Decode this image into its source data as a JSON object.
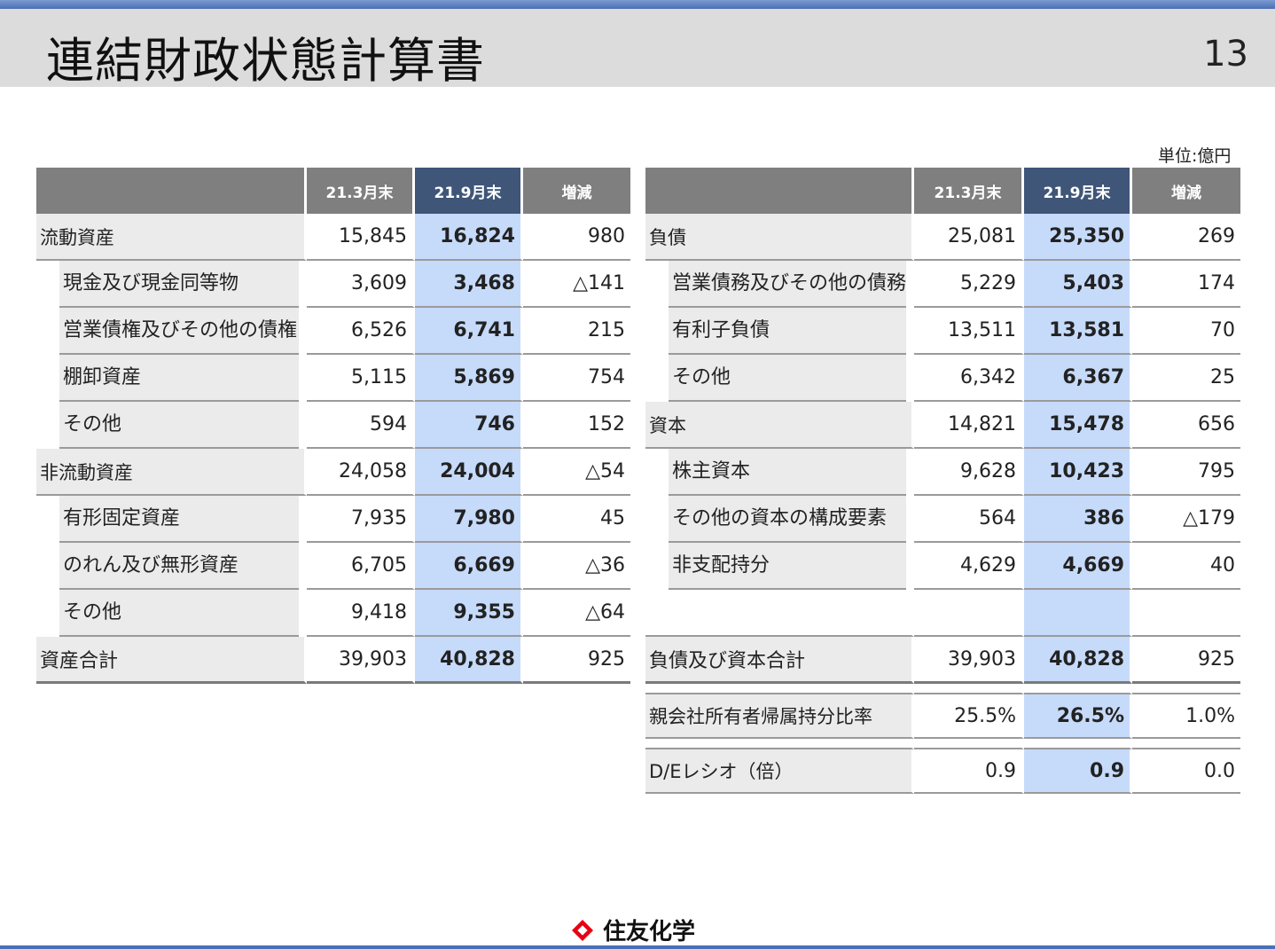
{
  "header": {
    "title": "連結財政状態計算書",
    "page_number": "13"
  },
  "unit_label": "単位:億円",
  "columns": {
    "prev": "21.3月末",
    "cur": "21.9月末",
    "diff": "増減"
  },
  "left_rows": [
    {
      "type": "cat",
      "label": "流動資産",
      "prev": "15,845",
      "cur": "16,824",
      "diff": "980"
    },
    {
      "type": "sub",
      "label": "現金及び現金同等物",
      "prev": "3,609",
      "cur": "3,468",
      "diff": "△141"
    },
    {
      "type": "sub",
      "label": "営業債権及びその他の債権",
      "prev": "6,526",
      "cur": "6,741",
      "diff": "215"
    },
    {
      "type": "sub",
      "label": "棚卸資産",
      "prev": "5,115",
      "cur": "5,869",
      "diff": "754"
    },
    {
      "type": "sub",
      "label": "その他",
      "prev": "594",
      "cur": "746",
      "diff": "152"
    },
    {
      "type": "cat",
      "label": "非流動資産",
      "prev": "24,058",
      "cur": "24,004",
      "diff": "△54"
    },
    {
      "type": "sub",
      "label": "有形固定資産",
      "prev": "7,935",
      "cur": "7,980",
      "diff": "45"
    },
    {
      "type": "sub",
      "label": "のれん及び無形資産",
      "prev": "6,705",
      "cur": "6,669",
      "diff": "△36"
    },
    {
      "type": "sub",
      "label": "その他",
      "prev": "9,418",
      "cur": "9,355",
      "diff": "△64"
    },
    {
      "type": "total",
      "label": "資産合計",
      "prev": "39,903",
      "cur": "40,828",
      "diff": "925"
    }
  ],
  "right_rows": [
    {
      "type": "cat",
      "label": "負債",
      "prev": "25,081",
      "cur": "25,350",
      "diff": "269"
    },
    {
      "type": "sub",
      "label": "営業債務及びその他の債務",
      "prev": "5,229",
      "cur": "5,403",
      "diff": "174"
    },
    {
      "type": "sub",
      "label": "有利子負債",
      "prev": "13,511",
      "cur": "13,581",
      "diff": "70"
    },
    {
      "type": "sub",
      "label": "その他",
      "prev": "6,342",
      "cur": "6,367",
      "diff": "25"
    },
    {
      "type": "cat",
      "label": "資本",
      "prev": "14,821",
      "cur": "15,478",
      "diff": "656"
    },
    {
      "type": "sub",
      "label": "株主資本",
      "prev": "9,628",
      "cur": "10,423",
      "diff": "795"
    },
    {
      "type": "sub",
      "label": "その他の資本の構成要素",
      "prev": "564",
      "cur": "386",
      "diff": "△179"
    },
    {
      "type": "sub",
      "label": "非支配持分",
      "prev": "4,629",
      "cur": "4,669",
      "diff": "40"
    },
    {
      "type": "empty",
      "label": "",
      "prev": "",
      "cur": "",
      "diff": ""
    },
    {
      "type": "total",
      "label": "負債及び資本合計",
      "prev": "39,903",
      "cur": "40,828",
      "diff": "925"
    }
  ],
  "ratio_rows": [
    {
      "label": "親会社所有者帰属持分比率",
      "prev": "25.5%",
      "cur": "26.5%",
      "diff": "1.0%"
    },
    {
      "label": "D/Eレシオ（倍）",
      "prev": "0.9",
      "cur": "0.9",
      "diff": "0.0"
    }
  ],
  "logo": {
    "text": "住友化学",
    "icon": "sumitomo-igeta-icon",
    "color": "#e60012"
  }
}
